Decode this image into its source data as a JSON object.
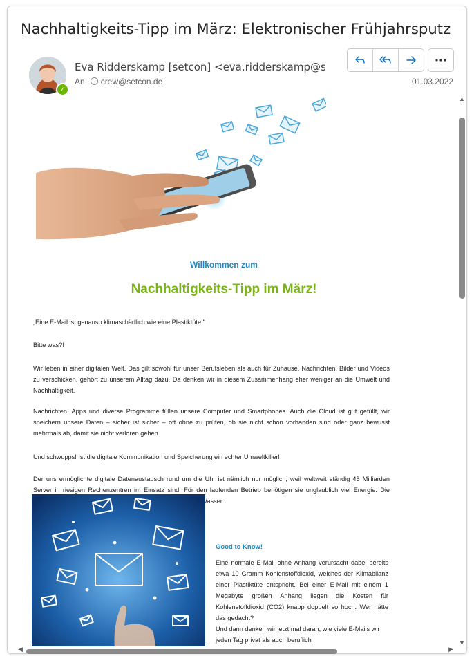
{
  "email": {
    "subject": "Nachhaltigkeits-Tipp im März: Elektronischer Frühjahrsputz",
    "sender": "Eva Ridderskamp [setcon] <eva.ridderskamp@setcon.de>",
    "to_label": "An",
    "to_address": "crew@setcon.de",
    "date": "01.03.2022"
  },
  "actions": {
    "reply_icon": "reply-icon",
    "reply_all_icon": "reply-all-icon",
    "forward_icon": "forward-icon",
    "more_icon": "more-icon"
  },
  "newsletter": {
    "welcome": "Willkommen zum",
    "headline": "Nachhaltigkeits-Tipp im März!",
    "quote": "„Eine E-Mail ist genauso klimaschädlich wie eine Plastiktüte!\"",
    "reaction": "Bitte was?!",
    "p1": "Wir leben in einer digitalen Welt. Das gilt sowohl für unser Berufsleben als auch für Zuhause. Nachrichten, Bilder und Videos zu verschicken, gehört zu unserem Alltag dazu. Da denken wir in diesem Zusammenhang eher weniger an die Umwelt und Nachhaltigkeit.",
    "p2": "Nachrichten, Apps und diverse Programme füllen unsere Computer und Smartphones. Auch die Cloud ist gut gefüllt, wir speichern unsere Daten – sicher ist sicher – oft ohne zu prüfen, ob sie nicht schon vorhanden sind oder ganz bewusst mehrmals ab, damit sie nicht verloren gehen.",
    "p3": "Und schwupps! Ist die digitale Kommunikation und Speicherung ein echter Umweltkiller!",
    "p4": "Der uns ermöglichte digitale Datenaustausch rund um die Uhr ist nämlich nur möglich, weil weltweit ständig 45 Milliarden Server in riesigen Rechenzentren im Einsatz sind. Für den laufenden Betrieb benötigen sie unglaublich viel Energie. Die permanente Kühlung der Server frisst zusätzlich Strom und Wasser.",
    "good_to_know_title": "Good to Know!",
    "good_to_know_text": "Eine normale E-Mail ohne Anhang verursacht dabei bereits etwa 10 Gramm Kohlenstoffdioxid, welches der Klimabilanz einer Plastiktüte entspricht. Bei einer E-Mail mit einem 1 Megabyte großen Anhang liegen die Kosten für Kohlenstoffdioxid (CO2) knapp doppelt so hoch. Wer hätte das gedacht?",
    "good_to_know_text2": "Und dann denken wir jetzt mal daran, wie viele E-Mails wir jeden Tag privat als auch beruflich"
  },
  "colors": {
    "accent_blue": "#1a8ac6",
    "accent_green": "#7ab317",
    "outlook_blue": "#0f6cbd",
    "presence_green": "#6bb700"
  }
}
